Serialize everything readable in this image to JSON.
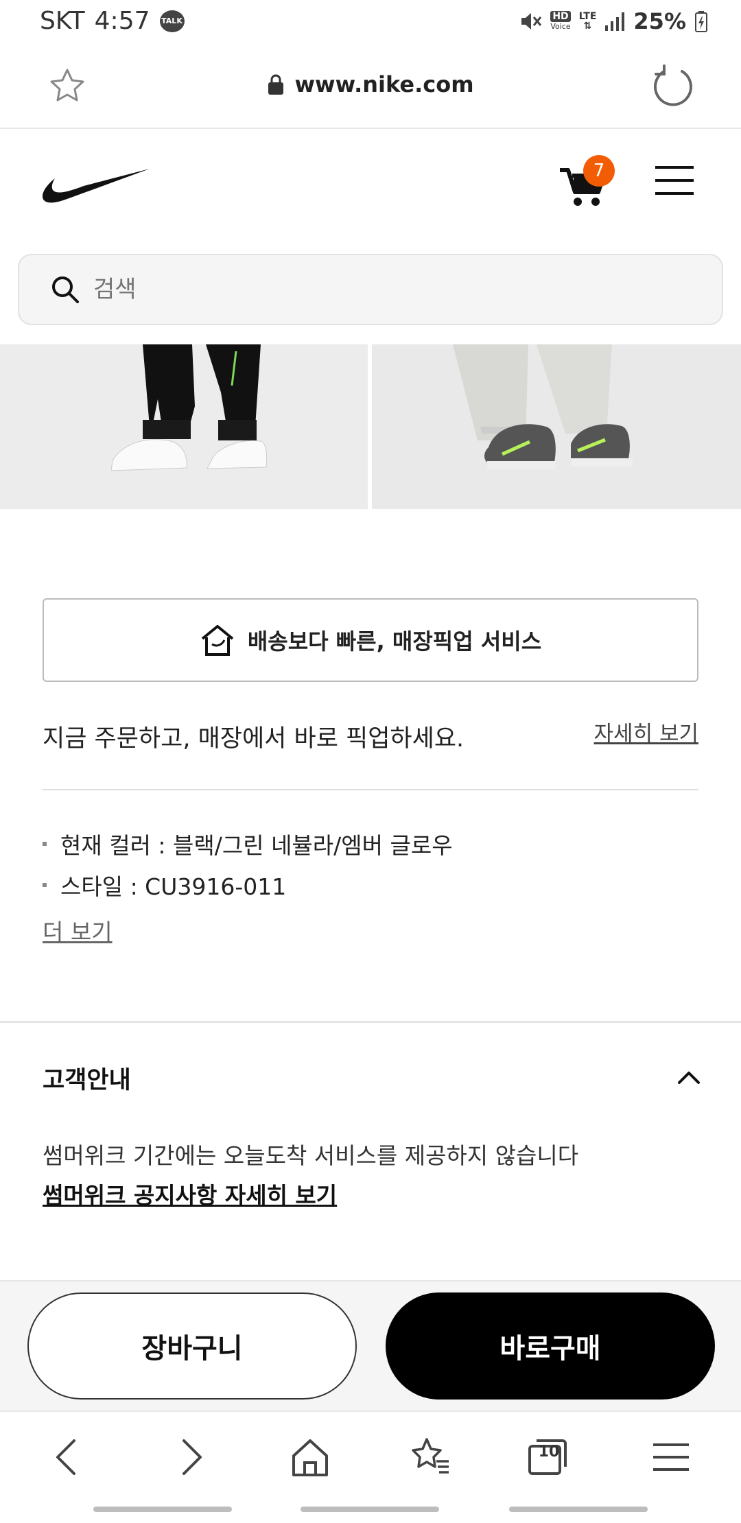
{
  "status_bar": {
    "carrier": "SKT",
    "time": "4:57",
    "talk_label": "TALK",
    "hd_label": "HD",
    "voice_label": "Voice",
    "lte_label": "LTE",
    "battery": "25%"
  },
  "browser": {
    "url": "www.nike.com"
  },
  "header": {
    "cart_count": "7"
  },
  "search": {
    "placeholder": "검색"
  },
  "pickup": {
    "button_label": "배송보다 빠른, 매장픽업 서비스",
    "description": "지금 주문하고, 매장에서 바로 픽업하세요.",
    "details_link": "자세히 보기"
  },
  "product_info": {
    "items": [
      "현재 컬러 : 블랙/그린 네뷸라/엠버 글로우",
      "스타일 : CU3916-011"
    ],
    "more_link": "더 보기"
  },
  "customer_notice": {
    "title": "고객안내",
    "text": "썸머위크 기간에는 오늘도착 서비스를 제공하지 않습니다",
    "link": "썸머위크 공지사항 자세히 보기"
  },
  "purchase": {
    "cart_label": "장바구니",
    "buy_label": "바로구매"
  },
  "bottom_nav": {
    "tab_count": "10"
  },
  "colors": {
    "badge": "#f25c05",
    "buy_button": "#000000"
  }
}
